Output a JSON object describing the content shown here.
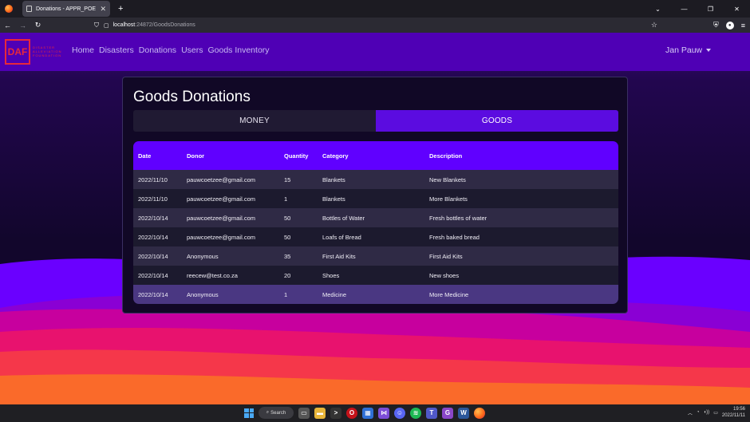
{
  "browser": {
    "tab_title": "Donations - APPR_POE",
    "tab_close": "✕",
    "new_tab": "+",
    "url_host": "localhost",
    "url_rest": ":24872/GoodsDonations",
    "window_controls": [
      "⌄",
      "—",
      "❐",
      "✕"
    ]
  },
  "site": {
    "logo_text": "DAF",
    "logo_sub": [
      "DISASTER",
      "ALLEVIATION",
      "FOUNDATION"
    ],
    "nav": [
      "Home",
      "Disasters",
      "Donations",
      "Users",
      "Goods Inventory"
    ],
    "user": "Jan Pauw"
  },
  "main": {
    "title": "Goods Donations",
    "toggle": {
      "money": "MONEY",
      "goods": "GOODS",
      "active": "goods"
    },
    "table": {
      "headers": [
        "Date",
        "Donor",
        "Quantity",
        "Category",
        "Description"
      ],
      "rows": [
        [
          "2022/11/10",
          "pauwcoetzee@gmail.com",
          "15",
          "Blankets",
          "New Blankets"
        ],
        [
          "2022/11/10",
          "pauwcoetzee@gmail.com",
          "1",
          "Blankets",
          "More Blankets"
        ],
        [
          "2022/10/14",
          "pauwcoetzee@gmail.com",
          "50",
          "Bottles of Water",
          "Fresh bottles of water"
        ],
        [
          "2022/10/14",
          "pauwcoetzee@gmail.com",
          "50",
          "Loafs of Bread",
          "Fresh baked bread"
        ],
        [
          "2022/10/14",
          "Anonymous",
          "35",
          "First Aid Kits",
          "First Aid Kits"
        ],
        [
          "2022/10/14",
          "reecew@test.co.za",
          "20",
          "Shoes",
          "New shoes"
        ],
        [
          "2022/10/14",
          "Anonymous",
          "1",
          "Medicine",
          "More Medicine"
        ]
      ]
    }
  },
  "taskbar": {
    "search_label": "Search",
    "time": "19:56",
    "date": "2022/11/11"
  },
  "colors": {
    "accent": "#6000ff",
    "nav_bg": "#4f00b5",
    "logo_red": "#e8283c"
  }
}
